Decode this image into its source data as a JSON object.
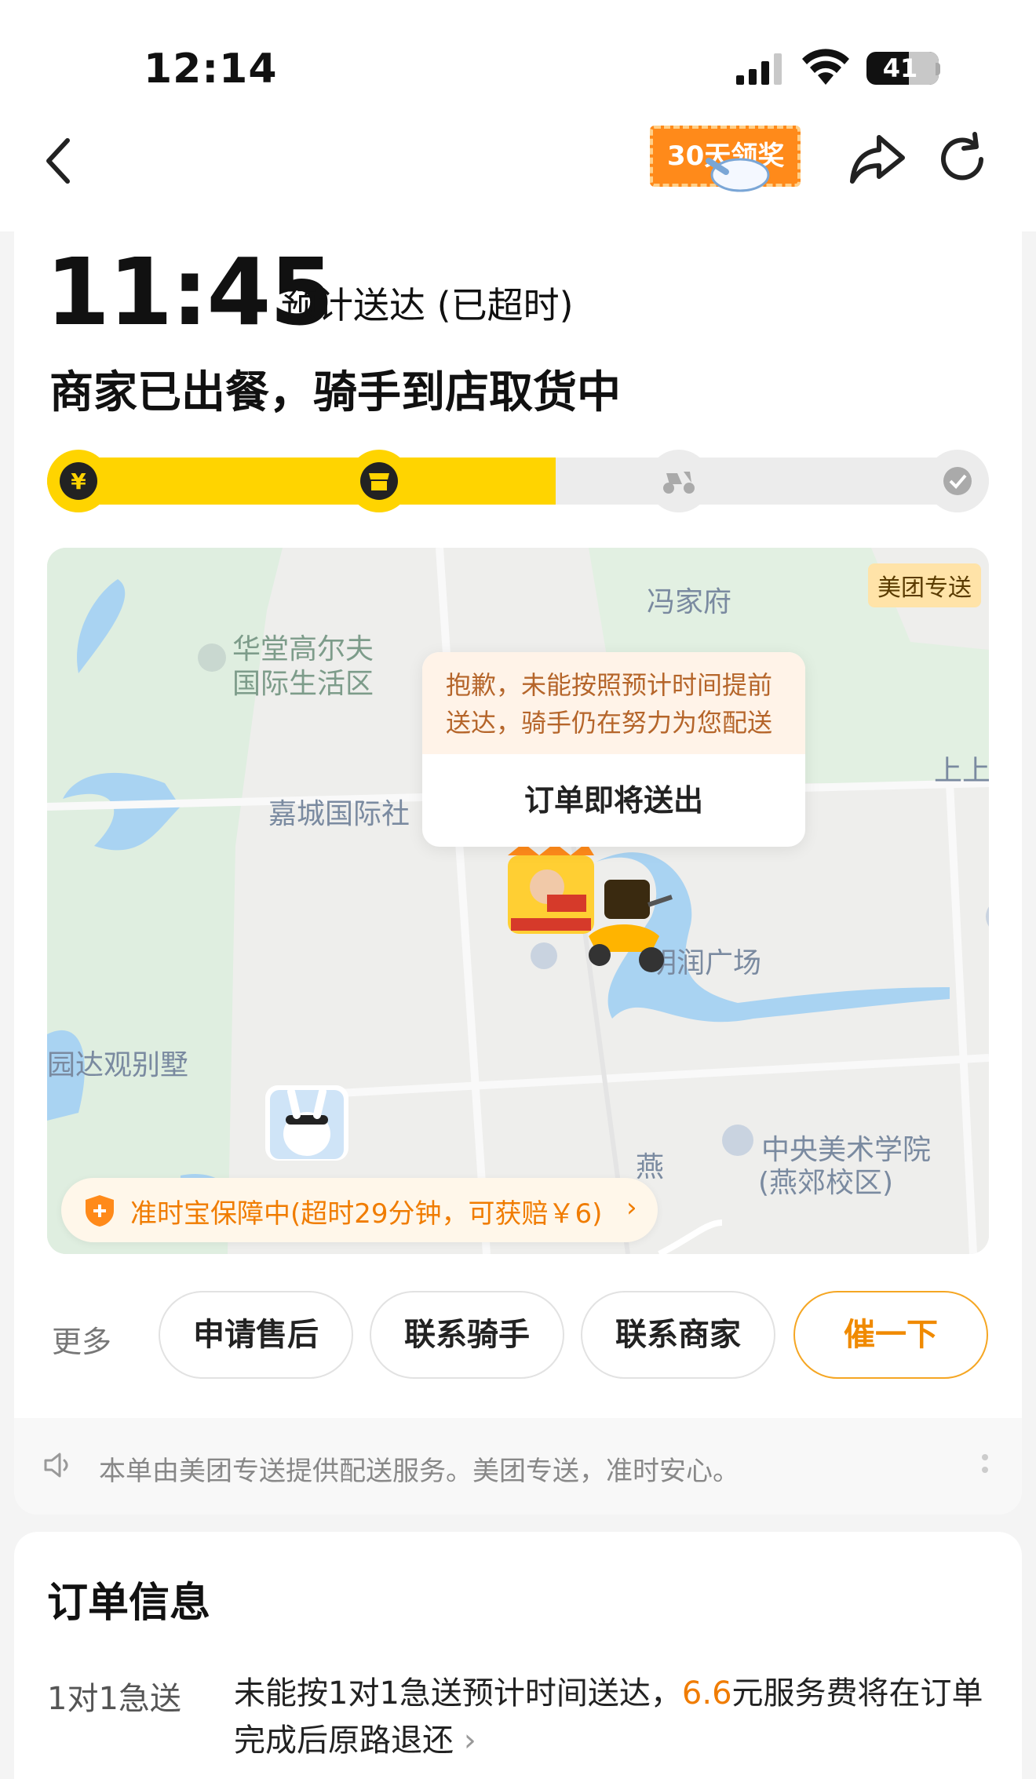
{
  "status_bar": {
    "time": "12:14",
    "battery": "41"
  },
  "nav": {
    "promo_label": "30天领奖"
  },
  "eta": {
    "time": "11:45",
    "label": "预计送达 (已超时)"
  },
  "order_status": "商家已出餐，骑手到店取货中",
  "progress": {
    "steps": [
      "paid",
      "restaurant",
      "rider",
      "delivered"
    ],
    "completed_steps": 2,
    "fill_fraction": 0.54,
    "accent_color": "#FFD400"
  },
  "map": {
    "provider_tag": "美团专送",
    "labels": {
      "fengjiafu": "冯家府",
      "huatang_line1": "华堂高尔夫",
      "huatang_line2": "国际生活区",
      "jiacheng": "嘉城国际社",
      "shangshang": "上上",
      "mingrun": "明润广场",
      "yuanda": "园达观别墅",
      "yan": "燕",
      "cafa_line1": "中央美术学院",
      "cafa_line2": "(燕郊校区)"
    },
    "popup": {
      "apology_line1": "抱歉，未能按照预计时间提前",
      "apology_line2": "送达，骑手仍在努力为您配送",
      "message": "订单即将送出"
    },
    "guarantee": "准时宝保障中(超时29分钟，可获赔￥6)"
  },
  "actions": {
    "more_label": "更多",
    "after_sales": "申请售后",
    "contact_rider": "联系骑手",
    "contact_merchant": "联系商家",
    "urge": "催一下"
  },
  "notice": "本单由美团专送提供配送服务。美团专送，准时安心。",
  "order_info": {
    "title": "订单信息",
    "express_label": "1对1急送",
    "express_text_before": "未能按1对1急送预计时间送达，",
    "express_fee": "6.6",
    "express_text_after": "元服务费将在订单完成后原路退还"
  }
}
